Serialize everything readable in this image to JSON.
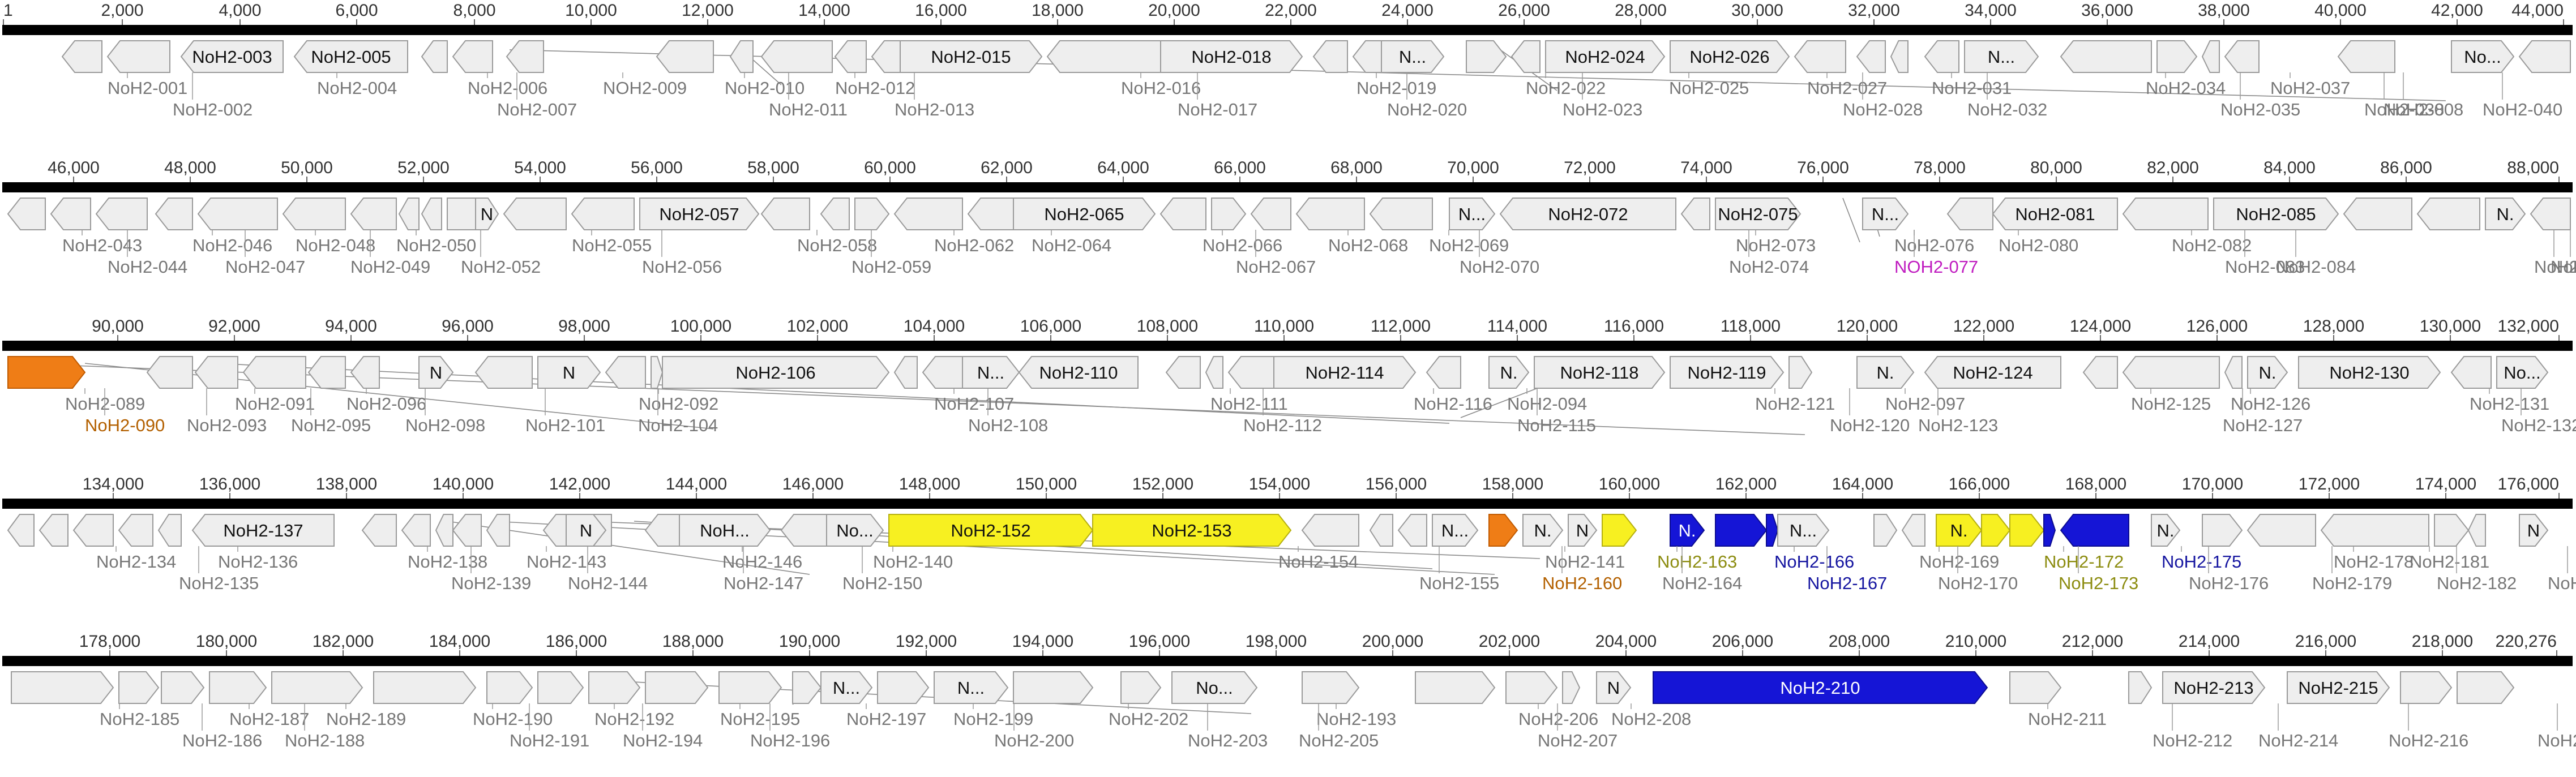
{
  "colors": {
    "ruler": "#000000",
    "gene_fill_default": "#eeeeee",
    "gene_stroke_default": "#9a9a9a",
    "label_default": "#777777",
    "inner_label": "#111111",
    "orange": "#ef7d16",
    "orange_label": "#b36000",
    "yellow": "#f7f021",
    "yellow_label": "#8c8c10",
    "blue": "#1515d6",
    "blue_label": "#1515a0",
    "magenta": "#d22dc8",
    "magenta_label": "#c01cc0"
  },
  "rows": [
    {
      "ticks": [
        "1",
        "2,000",
        "4,000",
        "6,000",
        "8,000",
        "10,000",
        "12,000",
        "14,000",
        "16,000",
        "18,000",
        "20,000",
        "22,000",
        "24,000",
        "26,000",
        "28,000",
        "30,000",
        "32,000",
        "34,000",
        "36,000",
        "38,000",
        "40,000",
        "42,000",
        "44,000"
      ],
      "inner": [
        {
          "text": "NoH2-003",
          "color": "default"
        },
        {
          "text": "NoH2-005",
          "color": "default"
        },
        {
          "text": "NoH2-015",
          "color": "default"
        },
        {
          "text": "NoH2-018",
          "color": "default"
        },
        {
          "text": "N...",
          "color": "default"
        },
        {
          "text": "NoH2-024",
          "color": "default"
        },
        {
          "text": "NoH2-026",
          "color": "default"
        },
        {
          "text": "N...",
          "color": "default"
        },
        {
          "text": "No...",
          "color": "default"
        },
        {
          "text": "N.",
          "color": "default"
        }
      ],
      "labels": [
        {
          "text": "NoH2-001",
          "color": "default"
        },
        {
          "text": "NoH2-004",
          "color": "default"
        },
        {
          "text": "NoH2-006",
          "color": "default"
        },
        {
          "text": "NOH2-009",
          "color": "default"
        },
        {
          "text": "NoH2-010",
          "color": "default"
        },
        {
          "text": "NoH2-012",
          "color": "default"
        },
        {
          "text": "NoH2-016",
          "color": "default"
        },
        {
          "text": "NoH2-019",
          "color": "default"
        },
        {
          "text": "NoH2-022",
          "color": "default"
        },
        {
          "text": "NoH2-025",
          "color": "default"
        },
        {
          "text": "NoH2-027",
          "color": "default"
        },
        {
          "text": "NoH2-031",
          "color": "default"
        },
        {
          "text": "NoH2-034",
          "color": "default"
        },
        {
          "text": "NoH2-037",
          "color": "default"
        },
        {
          "text": "NoH2-008",
          "color": "default"
        },
        {
          "text": "NoH2-002",
          "color": "default"
        },
        {
          "text": "NoH2-007",
          "color": "default"
        },
        {
          "text": "NoH2-011",
          "color": "default"
        },
        {
          "text": "NoH2-013",
          "color": "default"
        },
        {
          "text": "NoH2-017",
          "color": "default"
        },
        {
          "text": "NoH2-020",
          "color": "default"
        },
        {
          "text": "NoH2-023",
          "color": "default"
        },
        {
          "text": "NoH2-028",
          "color": "default"
        },
        {
          "text": "NoH2-032",
          "color": "default"
        },
        {
          "text": "NoH2-035",
          "color": "default"
        },
        {
          "text": "NoH2-038",
          "color": "default"
        },
        {
          "text": "NoH2-040",
          "color": "default"
        }
      ]
    },
    {
      "ticks": [
        "46,000",
        "48,000",
        "50,000",
        "52,000",
        "54,000",
        "56,000",
        "58,000",
        "60,000",
        "62,000",
        "64,000",
        "66,000",
        "68,000",
        "70,000",
        "72,000",
        "74,000",
        "76,000",
        "78,000",
        "80,000",
        "82,000",
        "84,000",
        "86,000",
        "88,000"
      ],
      "inner": [
        {
          "text": "N",
          "color": "default"
        },
        {
          "text": "NoH2-057",
          "color": "default"
        },
        {
          "text": "NoH2-065",
          "color": "default"
        },
        {
          "text": "N...",
          "color": "default"
        },
        {
          "text": "NoH2-072",
          "color": "default"
        },
        {
          "text": "NoH2-075",
          "color": "default"
        },
        {
          "text": "N...",
          "color": "default"
        },
        {
          "text": "NoH2-081",
          "color": "default"
        },
        {
          "text": "NoH2-085",
          "color": "default"
        },
        {
          "text": "N.",
          "color": "default"
        }
      ],
      "labels": [
        {
          "text": "NoH2-043",
          "color": "default"
        },
        {
          "text": "NoH2-046",
          "color": "default"
        },
        {
          "text": "NoH2-048",
          "color": "default"
        },
        {
          "text": "NoH2-050",
          "color": "default"
        },
        {
          "text": "NoH2-055",
          "color": "default"
        },
        {
          "text": "NoH2-058",
          "color": "default"
        },
        {
          "text": "NoH2-062",
          "color": "default"
        },
        {
          "text": "NoH2-064",
          "color": "default"
        },
        {
          "text": "NoH2-066",
          "color": "default"
        },
        {
          "text": "NoH2-068",
          "color": "default"
        },
        {
          "text": "NoH2-069",
          "color": "default"
        },
        {
          "text": "NoH2-073",
          "color": "default"
        },
        {
          "text": "NoH2-076",
          "color": "default"
        },
        {
          "text": "NoH2-080",
          "color": "default"
        },
        {
          "text": "NoH2-082",
          "color": "default"
        },
        {
          "text": "NoH2-084",
          "color": "default"
        },
        {
          "text": "NoH2-086",
          "color": "default"
        },
        {
          "text": "NoH2-044",
          "color": "default"
        },
        {
          "text": "NoH2-047",
          "color": "default"
        },
        {
          "text": "NoH2-049",
          "color": "default"
        },
        {
          "text": "NoH2-052",
          "color": "default"
        },
        {
          "text": "NoH2-056",
          "color": "default"
        },
        {
          "text": "NoH2-059",
          "color": "default"
        },
        {
          "text": "NoH2-067",
          "color": "default"
        },
        {
          "text": "NoH2-070",
          "color": "default"
        },
        {
          "text": "NoH2-074",
          "color": "default"
        },
        {
          "text": "NOH2-077",
          "color": "magenta"
        },
        {
          "text": "NoH2-083",
          "color": "default"
        },
        {
          "text": "NoH2-087",
          "color": "default"
        }
      ]
    },
    {
      "ticks": [
        "90,000",
        "92,000",
        "94,000",
        "96,000",
        "98,000",
        "100,000",
        "102,000",
        "104,000",
        "106,000",
        "108,000",
        "110,000",
        "112,000",
        "114,000",
        "116,000",
        "118,000",
        "120,000",
        "122,000",
        "124,000",
        "126,000",
        "128,000",
        "130,000",
        "132,000"
      ],
      "inner": [
        {
          "text": "N",
          "color": "default"
        },
        {
          "text": "N",
          "color": "default"
        },
        {
          "text": "NoH2-106",
          "color": "default"
        },
        {
          "text": "N...",
          "color": "default"
        },
        {
          "text": "NoH2-110",
          "color": "default"
        },
        {
          "text": "NoH2-114",
          "color": "default"
        },
        {
          "text": "N.",
          "color": "default"
        },
        {
          "text": "NoH2-118",
          "color": "default"
        },
        {
          "text": "NoH2-119",
          "color": "default"
        },
        {
          "text": "N.",
          "color": "default"
        },
        {
          "text": "NoH2-124",
          "color": "default"
        },
        {
          "text": "N.",
          "color": "default"
        },
        {
          "text": "NoH2-130",
          "color": "default"
        },
        {
          "text": "No...",
          "color": "default"
        }
      ],
      "labels": [
        {
          "text": "NoH2-089",
          "color": "default"
        },
        {
          "text": "NoH2-091",
          "color": "default"
        },
        {
          "text": "NoH2-096",
          "color": "default"
        },
        {
          "text": "NoH2-092",
          "color": "default"
        },
        {
          "text": "NoH2-107",
          "color": "default"
        },
        {
          "text": "NoH2-111",
          "color": "default"
        },
        {
          "text": "NoH2-116",
          "color": "default"
        },
        {
          "text": "NoH2-094",
          "color": "default"
        },
        {
          "text": "NoH2-121",
          "color": "default"
        },
        {
          "text": "NoH2-097",
          "color": "default"
        },
        {
          "text": "NoH2-125",
          "color": "default"
        },
        {
          "text": "NoH2-126",
          "color": "default"
        },
        {
          "text": "NoH2-131",
          "color": "default"
        },
        {
          "text": "NoH2-090",
          "color": "orange"
        },
        {
          "text": "NoH2-093",
          "color": "default"
        },
        {
          "text": "NoH2-095",
          "color": "default"
        },
        {
          "text": "NoH2-098",
          "color": "default"
        },
        {
          "text": "NoH2-101",
          "color": "default"
        },
        {
          "text": "NoH2-104",
          "color": "default"
        },
        {
          "text": "NoH2-108",
          "color": "default"
        },
        {
          "text": "NoH2-112",
          "color": "default"
        },
        {
          "text": "NoH2-115",
          "color": "default"
        },
        {
          "text": "NoH2-120",
          "color": "default"
        },
        {
          "text": "NoH2-123",
          "color": "default"
        },
        {
          "text": "NoH2-127",
          "color": "default"
        },
        {
          "text": "NoH2-132",
          "color": "default"
        }
      ]
    },
    {
      "ticks": [
        "134,000",
        "136,000",
        "138,000",
        "140,000",
        "142,000",
        "144,000",
        "146,000",
        "148,000",
        "150,000",
        "152,000",
        "154,000",
        "156,000",
        "158,000",
        "160,000",
        "162,000",
        "164,000",
        "166,000",
        "168,000",
        "170,000",
        "172,000",
        "174,000",
        "176,000"
      ],
      "inner": [
        {
          "text": "NoH2-137",
          "color": "default"
        },
        {
          "text": "N",
          "color": "default"
        },
        {
          "text": "NoH...",
          "color": "default"
        },
        {
          "text": "No...",
          "color": "default"
        },
        {
          "text": "NoH2-152",
          "color": "yellow"
        },
        {
          "text": "NoH2-153",
          "color": "yellow"
        },
        {
          "text": "N...",
          "color": "default"
        },
        {
          "text": "N.",
          "color": "default"
        },
        {
          "text": "N",
          "color": "default"
        },
        {
          "text": "N.",
          "color": "blue"
        },
        {
          "text": "N...",
          "color": "default"
        },
        {
          "text": "N.",
          "color": "yellow"
        },
        {
          "text": "N.",
          "color": "default"
        },
        {
          "text": "N",
          "color": "default"
        }
      ],
      "labels": [
        {
          "text": "NoH2-134",
          "color": "default"
        },
        {
          "text": "NoH2-136",
          "color": "default"
        },
        {
          "text": "NoH2-138",
          "color": "default"
        },
        {
          "text": "NoH2-143",
          "color": "default"
        },
        {
          "text": "NoH2-146",
          "color": "default"
        },
        {
          "text": "NoH2-140",
          "color": "default"
        },
        {
          "text": "NoH2-154",
          "color": "default"
        },
        {
          "text": "NoH2-141",
          "color": "default"
        },
        {
          "text": "NoH2-163",
          "color": "yellow"
        },
        {
          "text": "NoH2-166",
          "color": "blue"
        },
        {
          "text": "NoH2-169",
          "color": "default"
        },
        {
          "text": "NoH2-172",
          "color": "yellow"
        },
        {
          "text": "NoH2-175",
          "color": "blue"
        },
        {
          "text": "NoH2-178",
          "color": "default"
        },
        {
          "text": "NoH2-181",
          "color": "default"
        },
        {
          "text": "NoH2-183",
          "color": "default"
        },
        {
          "text": "NoH2-135",
          "color": "default"
        },
        {
          "text": "NoH2-139",
          "color": "default"
        },
        {
          "text": "NoH2-144",
          "color": "default"
        },
        {
          "text": "NoH2-147",
          "color": "default"
        },
        {
          "text": "NoH2-150",
          "color": "default"
        },
        {
          "text": "NoH2-155",
          "color": "default"
        },
        {
          "text": "NoH2-160",
          "color": "orange"
        },
        {
          "text": "NoH2-164",
          "color": "default"
        },
        {
          "text": "NoH2-167",
          "color": "blue"
        },
        {
          "text": "NoH2-170",
          "color": "default"
        },
        {
          "text": "NoH2-173",
          "color": "yellow"
        },
        {
          "text": "NoH2-176",
          "color": "default"
        },
        {
          "text": "NoH2-179",
          "color": "default"
        },
        {
          "text": "NoH2-182",
          "color": "default"
        }
      ]
    },
    {
      "ticks": [
        "178,000",
        "180,000",
        "182,000",
        "184,000",
        "186,000",
        "188,000",
        "190,000",
        "192,000",
        "194,000",
        "196,000",
        "198,000",
        "200,000",
        "202,000",
        "204,000",
        "206,000",
        "208,000",
        "210,000",
        "212,000",
        "214,000",
        "216,000",
        "218,000",
        "220,276"
      ],
      "inner": [
        {
          "text": "N...",
          "color": "default"
        },
        {
          "text": "N...",
          "color": "default"
        },
        {
          "text": "No...",
          "color": "default"
        },
        {
          "text": "N",
          "color": "default"
        },
        {
          "text": "NoH2-210",
          "color": "blue"
        },
        {
          "text": "NoH2-213",
          "color": "default"
        },
        {
          "text": "NoH2-215",
          "color": "default"
        }
      ],
      "labels": [
        {
          "text": "NoH2-185",
          "color": "default"
        },
        {
          "text": "NoH2-187",
          "color": "default"
        },
        {
          "text": "NoH2-189",
          "color": "default"
        },
        {
          "text": "NoH2-190",
          "color": "default"
        },
        {
          "text": "NoH2-192",
          "color": "default"
        },
        {
          "text": "NoH2-195",
          "color": "default"
        },
        {
          "text": "NoH2-197",
          "color": "default"
        },
        {
          "text": "NoH2-199",
          "color": "default"
        },
        {
          "text": "NoH2-202",
          "color": "default"
        },
        {
          "text": "NoH2-193",
          "color": "default"
        },
        {
          "text": "NoH2-206",
          "color": "default"
        },
        {
          "text": "NoH2-208",
          "color": "default"
        },
        {
          "text": "NoH2-211",
          "color": "default"
        },
        {
          "text": "NoH2-212",
          "color": "default"
        },
        {
          "text": "NoH2-214",
          "color": "default"
        },
        {
          "text": "NoH2-216",
          "color": "default"
        },
        {
          "text": "NoH2-186",
          "color": "default"
        },
        {
          "text": "NoH2-188",
          "color": "default"
        },
        {
          "text": "NoH2-191",
          "color": "default"
        },
        {
          "text": "NoH2-194",
          "color": "default"
        },
        {
          "text": "NoH2-196",
          "color": "default"
        },
        {
          "text": "NoH2-200",
          "color": "default"
        },
        {
          "text": "NoH2-203",
          "color": "default"
        },
        {
          "text": "NoH2-205",
          "color": "default"
        },
        {
          "text": "NoH2-207",
          "color": "default"
        },
        {
          "text": "NoH2-217",
          "color": "default"
        }
      ]
    }
  ]
}
